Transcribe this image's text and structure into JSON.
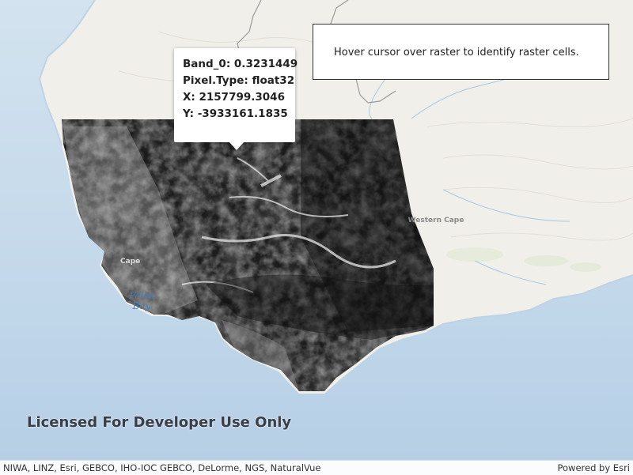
{
  "identify_popup": {
    "band_line": "Band_0: 0.3231449",
    "pixel_type_line": "Pixel.Type: float32",
    "x_line": "X: 2157799.3046",
    "y_line": "Y: -3933161.1835"
  },
  "instructions": {
    "text": "Hover cursor over raster to identify raster cells."
  },
  "map_labels": {
    "bay_line1": "False",
    "bay_line2": "Bay",
    "province": "Western Cape",
    "city_partial": "Cape"
  },
  "watermark": "Licensed For Developer Use Only",
  "attribution": {
    "credits": "NIWA, LINZ, Esri, GEBCO, IHO-IOC GEBCO, DeLorme, NGS, NaturalVue",
    "powered_by": "Powered by Esri"
  },
  "colors": {
    "ocean": "#c9dcec",
    "land": "#f1efe9",
    "raster_dark": "#1a1a1a",
    "bay_label": "#3f7fb8"
  }
}
